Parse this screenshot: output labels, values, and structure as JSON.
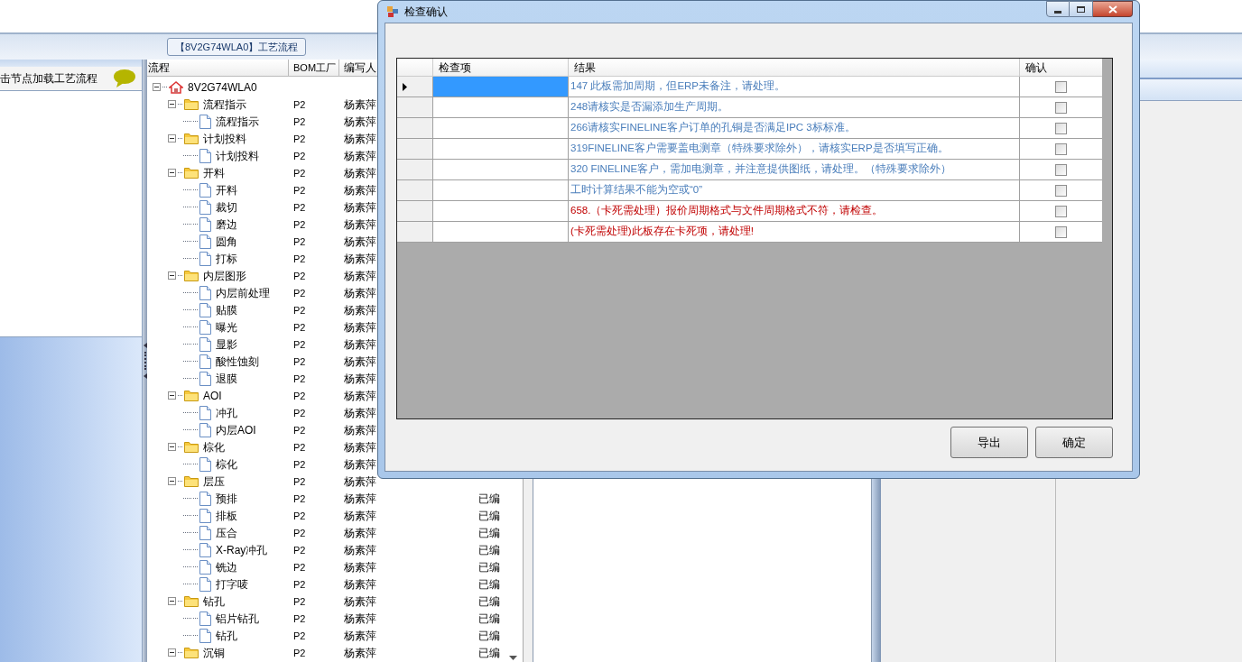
{
  "main": {
    "group_title": "【8V2G74WLA0】工艺流程",
    "left_panel": {
      "hint": "击节点加载工艺流程"
    },
    "tree_grid": {
      "columns": [
        "流程",
        "BOM工厂",
        "编写人"
      ],
      "tree": [
        {
          "label": "8V2G74WLA0",
          "kind": "root",
          "expanded": true,
          "children": [
            {
              "label": "流程指示",
              "kind": "folder",
              "expanded": true,
              "bom": "P2",
              "author": "杨素萍",
              "children": [
                {
                  "label": "流程指示",
                  "kind": "step",
                  "bom": "P2",
                  "author": "杨素萍"
                }
              ]
            },
            {
              "label": "计划投料",
              "kind": "folder",
              "expanded": true,
              "bom": "P2",
              "author": "杨素萍",
              "children": [
                {
                  "label": "计划投料",
                  "kind": "step",
                  "bom": "P2",
                  "author": "杨素萍"
                }
              ]
            },
            {
              "label": "开料",
              "kind": "folder",
              "expanded": true,
              "bom": "P2",
              "author": "杨素萍",
              "children": [
                {
                  "label": "开料",
                  "kind": "step",
                  "bom": "P2",
                  "author": "杨素萍"
                },
                {
                  "label": "裁切",
                  "kind": "step",
                  "bom": "P2",
                  "author": "杨素萍"
                },
                {
                  "label": "磨边",
                  "kind": "step",
                  "bom": "P2",
                  "author": "杨素萍"
                },
                {
                  "label": "圆角",
                  "kind": "step",
                  "bom": "P2",
                  "author": "杨素萍"
                },
                {
                  "label": "打标",
                  "kind": "step",
                  "bom": "P2",
                  "author": "杨素萍"
                }
              ]
            },
            {
              "label": "内层图形",
              "kind": "folder",
              "expanded": true,
              "bom": "P2",
              "author": "杨素萍",
              "children": [
                {
                  "label": "内层前处理",
                  "kind": "step",
                  "bom": "P2",
                  "author": "杨素萍"
                },
                {
                  "label": "贴膜",
                  "kind": "step",
                  "bom": "P2",
                  "author": "杨素萍"
                },
                {
                  "label": "曝光",
                  "kind": "step",
                  "bom": "P2",
                  "author": "杨素萍"
                },
                {
                  "label": "显影",
                  "kind": "step",
                  "bom": "P2",
                  "author": "杨素萍"
                },
                {
                  "label": "酸性蚀刻",
                  "kind": "step",
                  "bom": "P2",
                  "author": "杨素萍"
                },
                {
                  "label": "退膜",
                  "kind": "step",
                  "bom": "P2",
                  "author": "杨素萍"
                }
              ]
            },
            {
              "label": "AOI",
              "kind": "folder",
              "expanded": true,
              "bom": "P2",
              "author": "杨素萍",
              "children": [
                {
                  "label": "冲孔",
                  "kind": "step",
                  "bom": "P2",
                  "author": "杨素萍"
                },
                {
                  "label": "内层AOI",
                  "kind": "step",
                  "bom": "P2",
                  "author": "杨素萍"
                }
              ]
            },
            {
              "label": "棕化",
              "kind": "folder",
              "expanded": true,
              "bom": "P2",
              "author": "杨素萍",
              "children": [
                {
                  "label": "棕化",
                  "kind": "step",
                  "bom": "P2",
                  "author": "杨素萍"
                }
              ]
            },
            {
              "label": "层压",
              "kind": "folder",
              "expanded": true,
              "bom": "P2",
              "author": "杨素萍",
              "children": [
                {
                  "label": "预排",
                  "kind": "step",
                  "bom": "P2",
                  "author": "杨素萍",
                  "status": "已编"
                },
                {
                  "label": "排板",
                  "kind": "step",
                  "bom": "P2",
                  "author": "杨素萍",
                  "status": "已编"
                },
                {
                  "label": "压合",
                  "kind": "step",
                  "bom": "P2",
                  "author": "杨素萍",
                  "status": "已编"
                },
                {
                  "label": "X-Ray冲孔",
                  "kind": "step",
                  "bom": "P2",
                  "author": "杨素萍",
                  "status": "已编"
                },
                {
                  "label": "铣边",
                  "kind": "step",
                  "bom": "P2",
                  "author": "杨素萍",
                  "status": "已编"
                },
                {
                  "label": "打字唛",
                  "kind": "step",
                  "bom": "P2",
                  "author": "杨素萍",
                  "status": "已编"
                }
              ]
            },
            {
              "label": "钻孔",
              "kind": "folder",
              "expanded": true,
              "bom": "P2",
              "author": "杨素萍",
              "status": "已编",
              "children": [
                {
                  "label": "铝片钻孔",
                  "kind": "step",
                  "bom": "P2",
                  "author": "杨素萍",
                  "status": "已编"
                },
                {
                  "label": "钻孔",
                  "kind": "step",
                  "bom": "P2",
                  "author": "杨素萍",
                  "status": "已编"
                }
              ]
            },
            {
              "label": "沉铜",
              "kind": "folder",
              "expanded": true,
              "bom": "P2",
              "author": "杨素萍",
              "status": "已编"
            }
          ]
        }
      ]
    }
  },
  "dialog": {
    "title": "检查确认",
    "columns": [
      "检查项",
      "结果",
      "确认"
    ],
    "rows": [
      {
        "result": "147 此板需加周期，但ERP未备注，请处理。",
        "kind": "notice",
        "selected": true,
        "checked": false
      },
      {
        "result": "248请核实是否漏添加生产周期。",
        "kind": "notice",
        "selected": false,
        "checked": false
      },
      {
        "result": "266请核实FINELINE客户订单的孔铜是否满足IPC 3标标准。",
        "kind": "notice",
        "selected": false,
        "checked": false
      },
      {
        "result": "319FINELINE客户需要盖电测章（特殊要求除外），请核实ERP是否填写正确。",
        "kind": "notice",
        "selected": false,
        "checked": false
      },
      {
        "result": "320 FINELINE客户，需加电测章，并注意提供图纸，请处理。（特殊要求除外）",
        "kind": "notice",
        "selected": false,
        "checked": false
      },
      {
        "result": "工时计算结果不能为空或“0”",
        "kind": "notice",
        "selected": false,
        "checked": false
      },
      {
        "result": "658.（卡死需处理）报价周期格式与文件周期格式不符，请检查。",
        "kind": "blocking",
        "selected": false,
        "checked": false
      },
      {
        "result": "(卡死需处理)此板存在卡死项，请处理!",
        "kind": "blocking",
        "selected": false,
        "checked": false
      }
    ],
    "buttons": [
      "导出",
      "确定"
    ]
  }
}
